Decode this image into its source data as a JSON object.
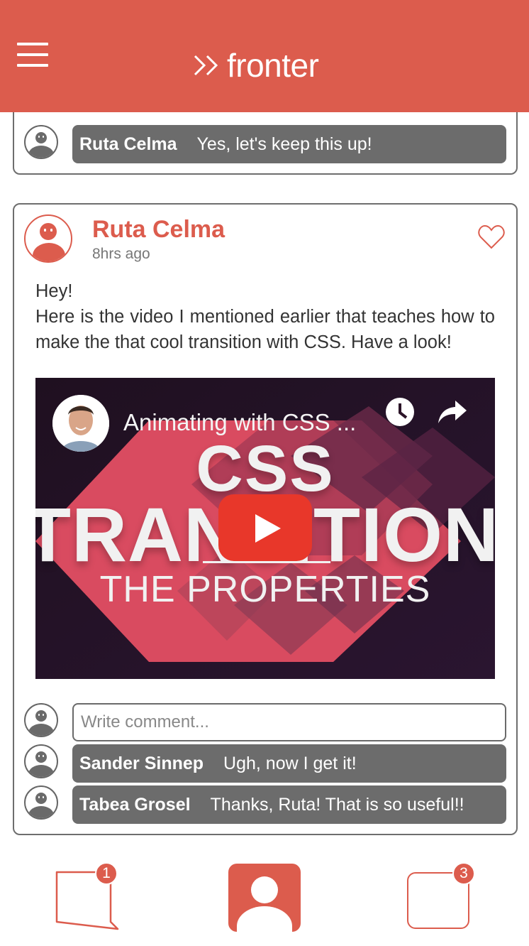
{
  "app": {
    "brand_name": "fronter",
    "accent_color": "#dc5c4d"
  },
  "previous_post": {
    "comments": [
      {
        "name": "Ruta Celma",
        "text": "Yes, let's keep this up!"
      }
    ]
  },
  "post": {
    "author": "Ruta Celma",
    "time": "8hrs ago",
    "liked": false,
    "text_lines": [
      "Hey!",
      "Here is the video I mentioned earlier that teaches how to make the that cool transition with CSS. Have a look!"
    ],
    "video": {
      "title": "Animating with CSS ...",
      "thumbnail_heading": "CSS",
      "thumbnail_heading_2": "TRANSITIONS",
      "thumbnail_subtitle": "THE PROPERTIES"
    },
    "comment_placeholder": "Write comment...",
    "comments": [
      {
        "name": "Sander Sinnep",
        "text": "Ugh, now I get it!"
      },
      {
        "name": "Tabea Grosel",
        "text": "Thanks, Ruta! That is so useful!!"
      }
    ]
  },
  "bottom_nav": {
    "messages_badge": "1",
    "notifications_badge": "3"
  }
}
